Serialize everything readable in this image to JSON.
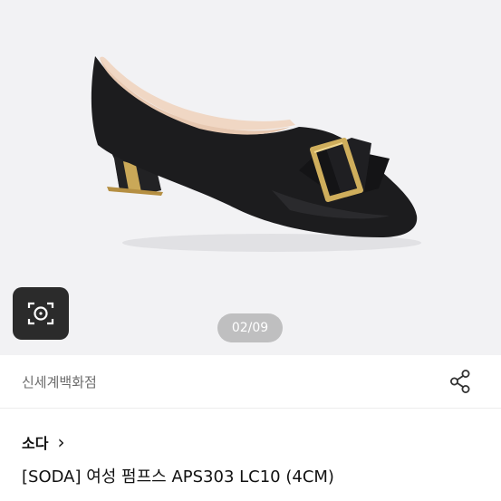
{
  "gallery": {
    "image_counter": "02/09",
    "image_alt": "black pumps with square buckle",
    "lens_icon": "camera-lens-icon"
  },
  "store": {
    "name": "신세계백화점",
    "share_icon": "share-icon"
  },
  "product": {
    "brand": "소다",
    "brand_chevron": "›",
    "title": "[SODA] 여성 펌프스 APS303 LC10 (4CM)"
  },
  "colors": {
    "gallery_bg": "#f2f2f4",
    "shoe": "#1d1d1f",
    "lining": "#e8c9b4",
    "buckle": "#c9a24f"
  }
}
